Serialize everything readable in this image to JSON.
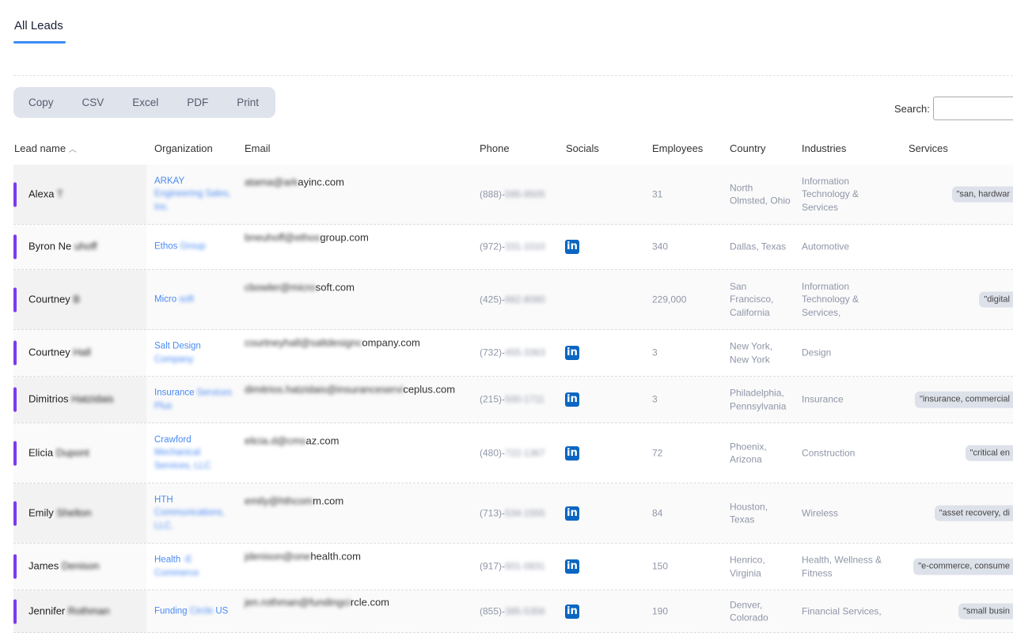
{
  "tab": {
    "label": "All Leads"
  },
  "export_buttons": [
    "Copy",
    "CSV",
    "Excel",
    "PDF",
    "Print"
  ],
  "search": {
    "label": "Search:",
    "value": ""
  },
  "columns": [
    "Lead name",
    "Organization",
    "Email",
    "Phone",
    "Socials",
    "Employees",
    "Country",
    "Industries",
    "Services"
  ],
  "sort": {
    "column": "Lead name",
    "direction": "ascending"
  },
  "colors": {
    "accent": "#7c3aed",
    "link": "#4a8af4",
    "tab_underline": "#3b8cf5",
    "linkedin": "#0a66c2"
  },
  "rows": [
    {
      "name": "Alexa",
      "name_hidden": "T",
      "org": "ARKAY",
      "org_hidden": "Engineering Sales, Inc.",
      "email_hidden": "atama@ark",
      "email": "ayinc.com",
      "phone": "(888)-",
      "phone_hidden": "595-9505",
      "linkedin": false,
      "employees": "31",
      "country": "North Olmsted, Ohio",
      "industries": "Information Technology & Services",
      "services": "\"san, hardwar"
    },
    {
      "name": "Byron Ne",
      "name_hidden": "uhoff",
      "org": "Ethos",
      "org_hidden": "Group",
      "email_hidden": "bneuhoff@ethos",
      "email": "group.com",
      "phone": "(972)-",
      "phone_hidden": "331-1010",
      "linkedin": true,
      "employees": "340",
      "country": "Dallas, Texas",
      "industries": "Automotive",
      "services": ""
    },
    {
      "name": "Courtney",
      "name_hidden": "B",
      "org": "Micro",
      "org_hidden": "soft",
      "email_hidden": "cbowler@micro",
      "email": "soft.com",
      "phone": "(425)-",
      "phone_hidden": "882-8080",
      "linkedin": false,
      "employees": "229,000",
      "country": "San Francisco, California",
      "industries": "Information Technology & Services,",
      "services": "\"digital"
    },
    {
      "name": "Courtney",
      "name_hidden": "Hall",
      "org": "Salt Design",
      "org_hidden": "Company",
      "email_hidden": "courtneyhall@saltdesignc",
      "email": "ompany.com",
      "phone": "(732)-",
      "phone_hidden": "455-3363",
      "linkedin": true,
      "employees": "3",
      "country": "New York, New York",
      "industries": "Design",
      "services": ""
    },
    {
      "name": "Dimitrios",
      "name_hidden": "Hatzidais",
      "org": "Insurance",
      "org_hidden": "Services Plus",
      "email_hidden": "dimitrios.hatzidais@insuranceservi",
      "email": "ceplus.com",
      "phone": "(215)-",
      "phone_hidden": "500-1711",
      "linkedin": true,
      "employees": "3",
      "country": "Philadelphia, Pennsylvania",
      "industries": "Insurance",
      "services": "\"insurance, commercial"
    },
    {
      "name": "Elicia",
      "name_hidden": "Dupont",
      "org": "Crawford",
      "org_hidden": "Mechanical Services, LLC",
      "email_hidden": "elicia.d@cms",
      "email": "az.com",
      "phone": "(480)-",
      "phone_hidden": "722-1367",
      "linkedin": true,
      "employees": "72",
      "country": "Phoenix, Arizona",
      "industries": "Construction",
      "services": "\"critical en"
    },
    {
      "name": "Emily",
      "name_hidden": "Shelton",
      "org": "HTH",
      "org_hidden": "Communications, LLC.",
      "email_hidden": "emily@hthcom",
      "email": "m.com",
      "phone": "(713)-",
      "phone_hidden": "534-1555",
      "linkedin": true,
      "employees": "84",
      "country": "Houston, Texas",
      "industries": "Wireless",
      "services": "\"asset recovery, di"
    },
    {
      "name": "James",
      "name_hidden": "Denison",
      "org": "Health",
      "org_hidden": "-E Commerce",
      "email_hidden": "jdenison@one",
      "email": "health.com",
      "phone": "(917)-",
      "phone_hidden": "601-0831",
      "linkedin": true,
      "employees": "150",
      "country": "Henrico, Virginia",
      "industries": "Health, Wellness & Fitness",
      "services": "\"e-commerce, consume"
    },
    {
      "name": "Jennifer",
      "name_hidden": "Rothman",
      "org": "Funding",
      "org_hidden": "Circle",
      "org_tail": "US",
      "email_hidden": "jen.rothman@fundingci",
      "email": "rcle.com",
      "phone": "(855)-",
      "phone_hidden": "385-5356",
      "linkedin": true,
      "employees": "190",
      "country": "Denver, Colorado",
      "industries": "Financial Services,",
      "services": "\"small busin"
    }
  ]
}
